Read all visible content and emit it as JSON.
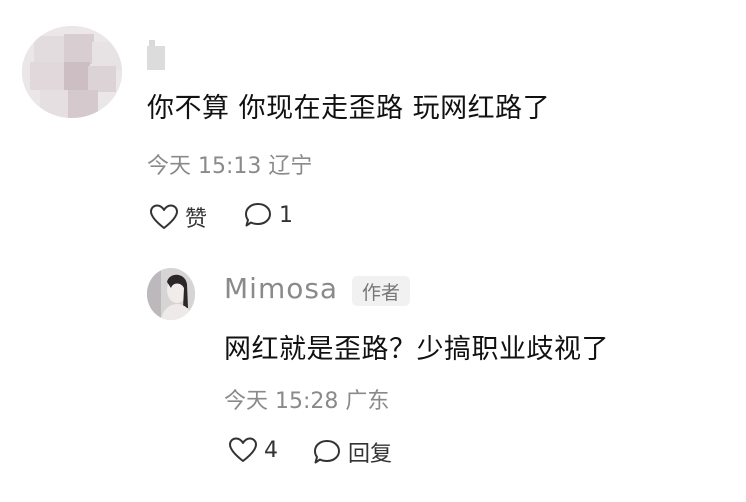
{
  "comment": {
    "text": "你不算 你现在走歪路 玩网红路了",
    "time": "今天 15:13",
    "location": "辽宁",
    "like_label": "赞",
    "reply_count": "1"
  },
  "reply": {
    "username": "Mimosa",
    "badge": "作者",
    "text": "网红就是歪路？少搞职业歧视了",
    "time": "今天 15:28",
    "location": "广东",
    "like_count": "4",
    "reply_label": "回复"
  },
  "icons": {
    "like": "heart-icon",
    "comment": "speech-bubble-icon"
  },
  "colors": {
    "text_primary": "#111111",
    "text_secondary": "#8a8a8a",
    "badge_bg": "#f1f1f1"
  }
}
